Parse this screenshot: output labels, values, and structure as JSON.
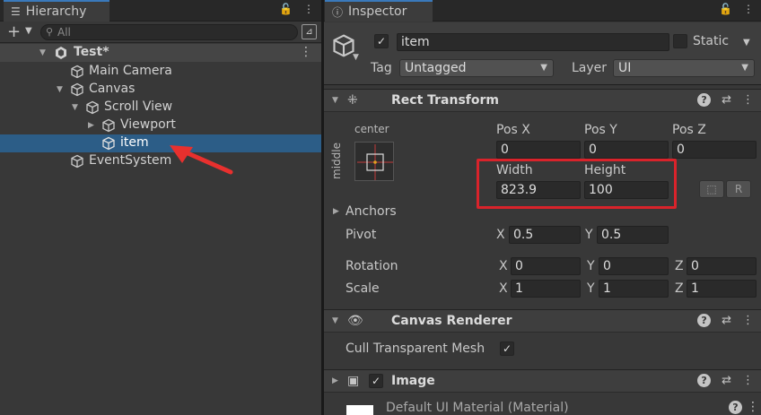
{
  "hierarchy": {
    "tab_title": "Hierarchy",
    "search_placeholder": "All",
    "scene_name": "Test*",
    "tree": [
      {
        "label": "Main Camera"
      },
      {
        "label": "Canvas"
      },
      {
        "label": "Scroll View"
      },
      {
        "label": "Viewport"
      },
      {
        "label": "item"
      },
      {
        "label": "EventSystem"
      }
    ]
  },
  "inspector": {
    "tab_title": "Inspector",
    "object_name": "item",
    "active": true,
    "static_label": "Static",
    "tag_label": "Tag",
    "tag_value": "Untagged",
    "layer_label": "Layer",
    "layer_value": "UI",
    "rect_transform": {
      "title": "Rect Transform",
      "anchor_h": "center",
      "anchor_v": "middle",
      "pos_x_label": "Pos X",
      "pos_y_label": "Pos Y",
      "pos_z_label": "Pos Z",
      "pos_x": "0",
      "pos_y": "0",
      "pos_z": "0",
      "width_label": "Width",
      "height_label": "Height",
      "width": "823.9",
      "height": "100",
      "anchors_label": "Anchors",
      "pivot_label": "Pivot",
      "pivot_x": "0.5",
      "pivot_y": "0.5",
      "rotation_label": "Rotation",
      "rot_x": "0",
      "rot_y": "0",
      "rot_z": "0",
      "scale_label": "Scale",
      "scale_x": "1",
      "scale_y": "1",
      "scale_z": "1",
      "axis_x": "X",
      "axis_y": "Y",
      "axis_z": "Z",
      "raw_button": "R"
    },
    "canvas_renderer": {
      "title": "Canvas Renderer",
      "cull_label": "Cull Transparent Mesh",
      "cull_checked": true
    },
    "image": {
      "title": "Image",
      "material": "Default UI Material (Material)"
    }
  },
  "colors": {
    "selection": "#2c5d87",
    "highlight_box": "#d9232b",
    "annotation_arrow": "#e8302e"
  }
}
